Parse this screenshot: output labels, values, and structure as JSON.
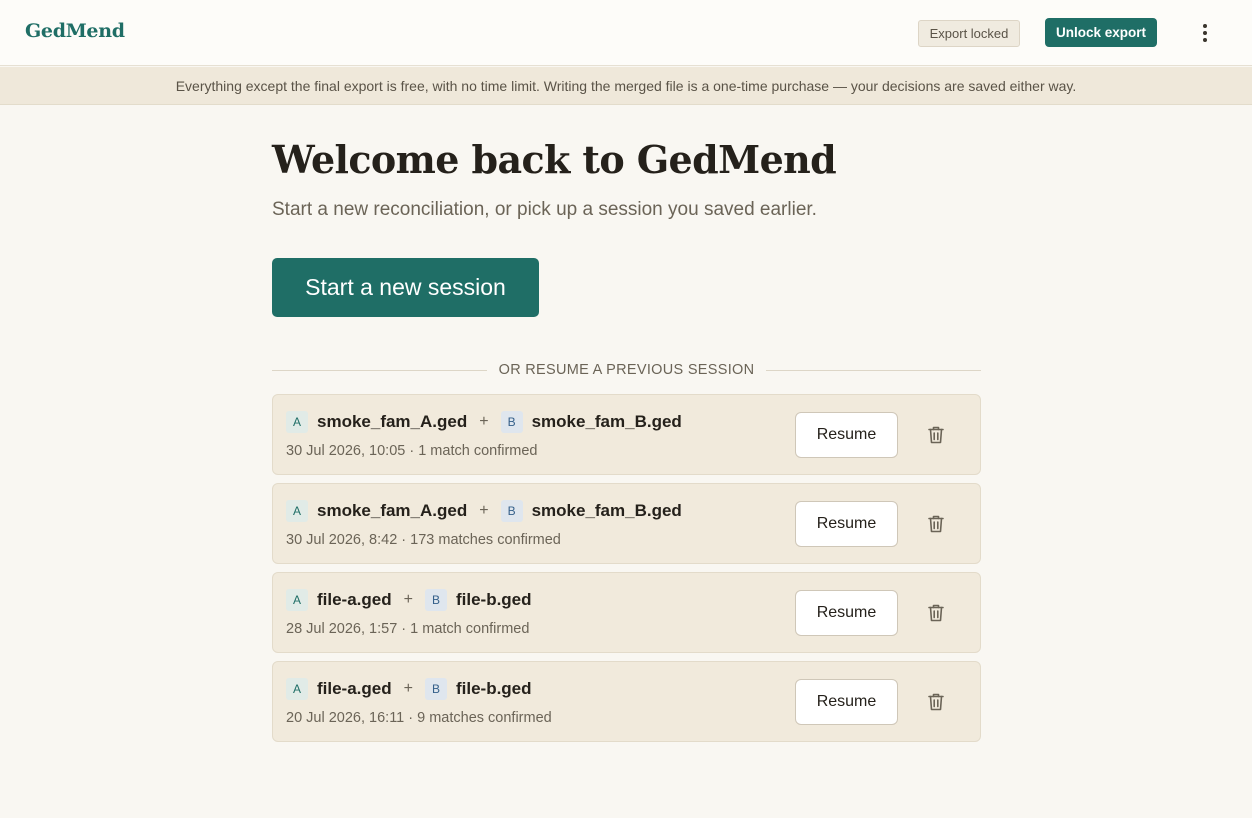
{
  "header": {
    "brand": "GedMend",
    "export_status": "Export locked",
    "unlock_label": "Unlock export",
    "menu_icon": "more-vertical-icon"
  },
  "notice": {
    "text": "Everything except the final export is free, with no time limit. Writing the merged file is a one-time purchase — your decisions are saved either way."
  },
  "hero": {
    "title": "Welcome back to GedMend",
    "subtitle": "Start a new reconciliation, or pick up a session you saved earlier.",
    "start_label": "Start a new session"
  },
  "resume_section": {
    "divider_label": "OR RESUME A PREVIOUS SESSION",
    "sessions": [
      {
        "tag_a": "A",
        "file_a": "smoke_fam_A.ged",
        "plus": "+",
        "tag_b": "B",
        "file_b": "smoke_fam_B.ged",
        "meta": "30 Jul 2026, 10:05 · 1 match confirmed",
        "resume_label": "Resume",
        "delete_icon": "trash-icon"
      },
      {
        "tag_a": "A",
        "file_a": "smoke_fam_A.ged",
        "plus": "+",
        "tag_b": "B",
        "file_b": "smoke_fam_B.ged",
        "meta": "30 Jul 2026, 8:42 · 173 matches confirmed",
        "resume_label": "Resume",
        "delete_icon": "trash-icon"
      },
      {
        "tag_a": "A",
        "file_a": "file-a.ged",
        "plus": "+",
        "tag_b": "B",
        "file_b": "file-b.ged",
        "meta": "28 Jul 2026, 1:57 · 1 match confirmed",
        "resume_label": "Resume",
        "delete_icon": "trash-icon"
      },
      {
        "tag_a": "A",
        "file_a": "file-a.ged",
        "plus": "+",
        "tag_b": "B",
        "file_b": "file-b.ged",
        "meta": "20 Jul 2026, 16:11 · 9 matches confirmed",
        "resume_label": "Resume",
        "delete_icon": "trash-icon"
      }
    ]
  },
  "colors": {
    "accent": "#1f6e66",
    "background": "#f9f7f2",
    "card": "#f1eadc",
    "notice_bar": "#efe8da"
  }
}
